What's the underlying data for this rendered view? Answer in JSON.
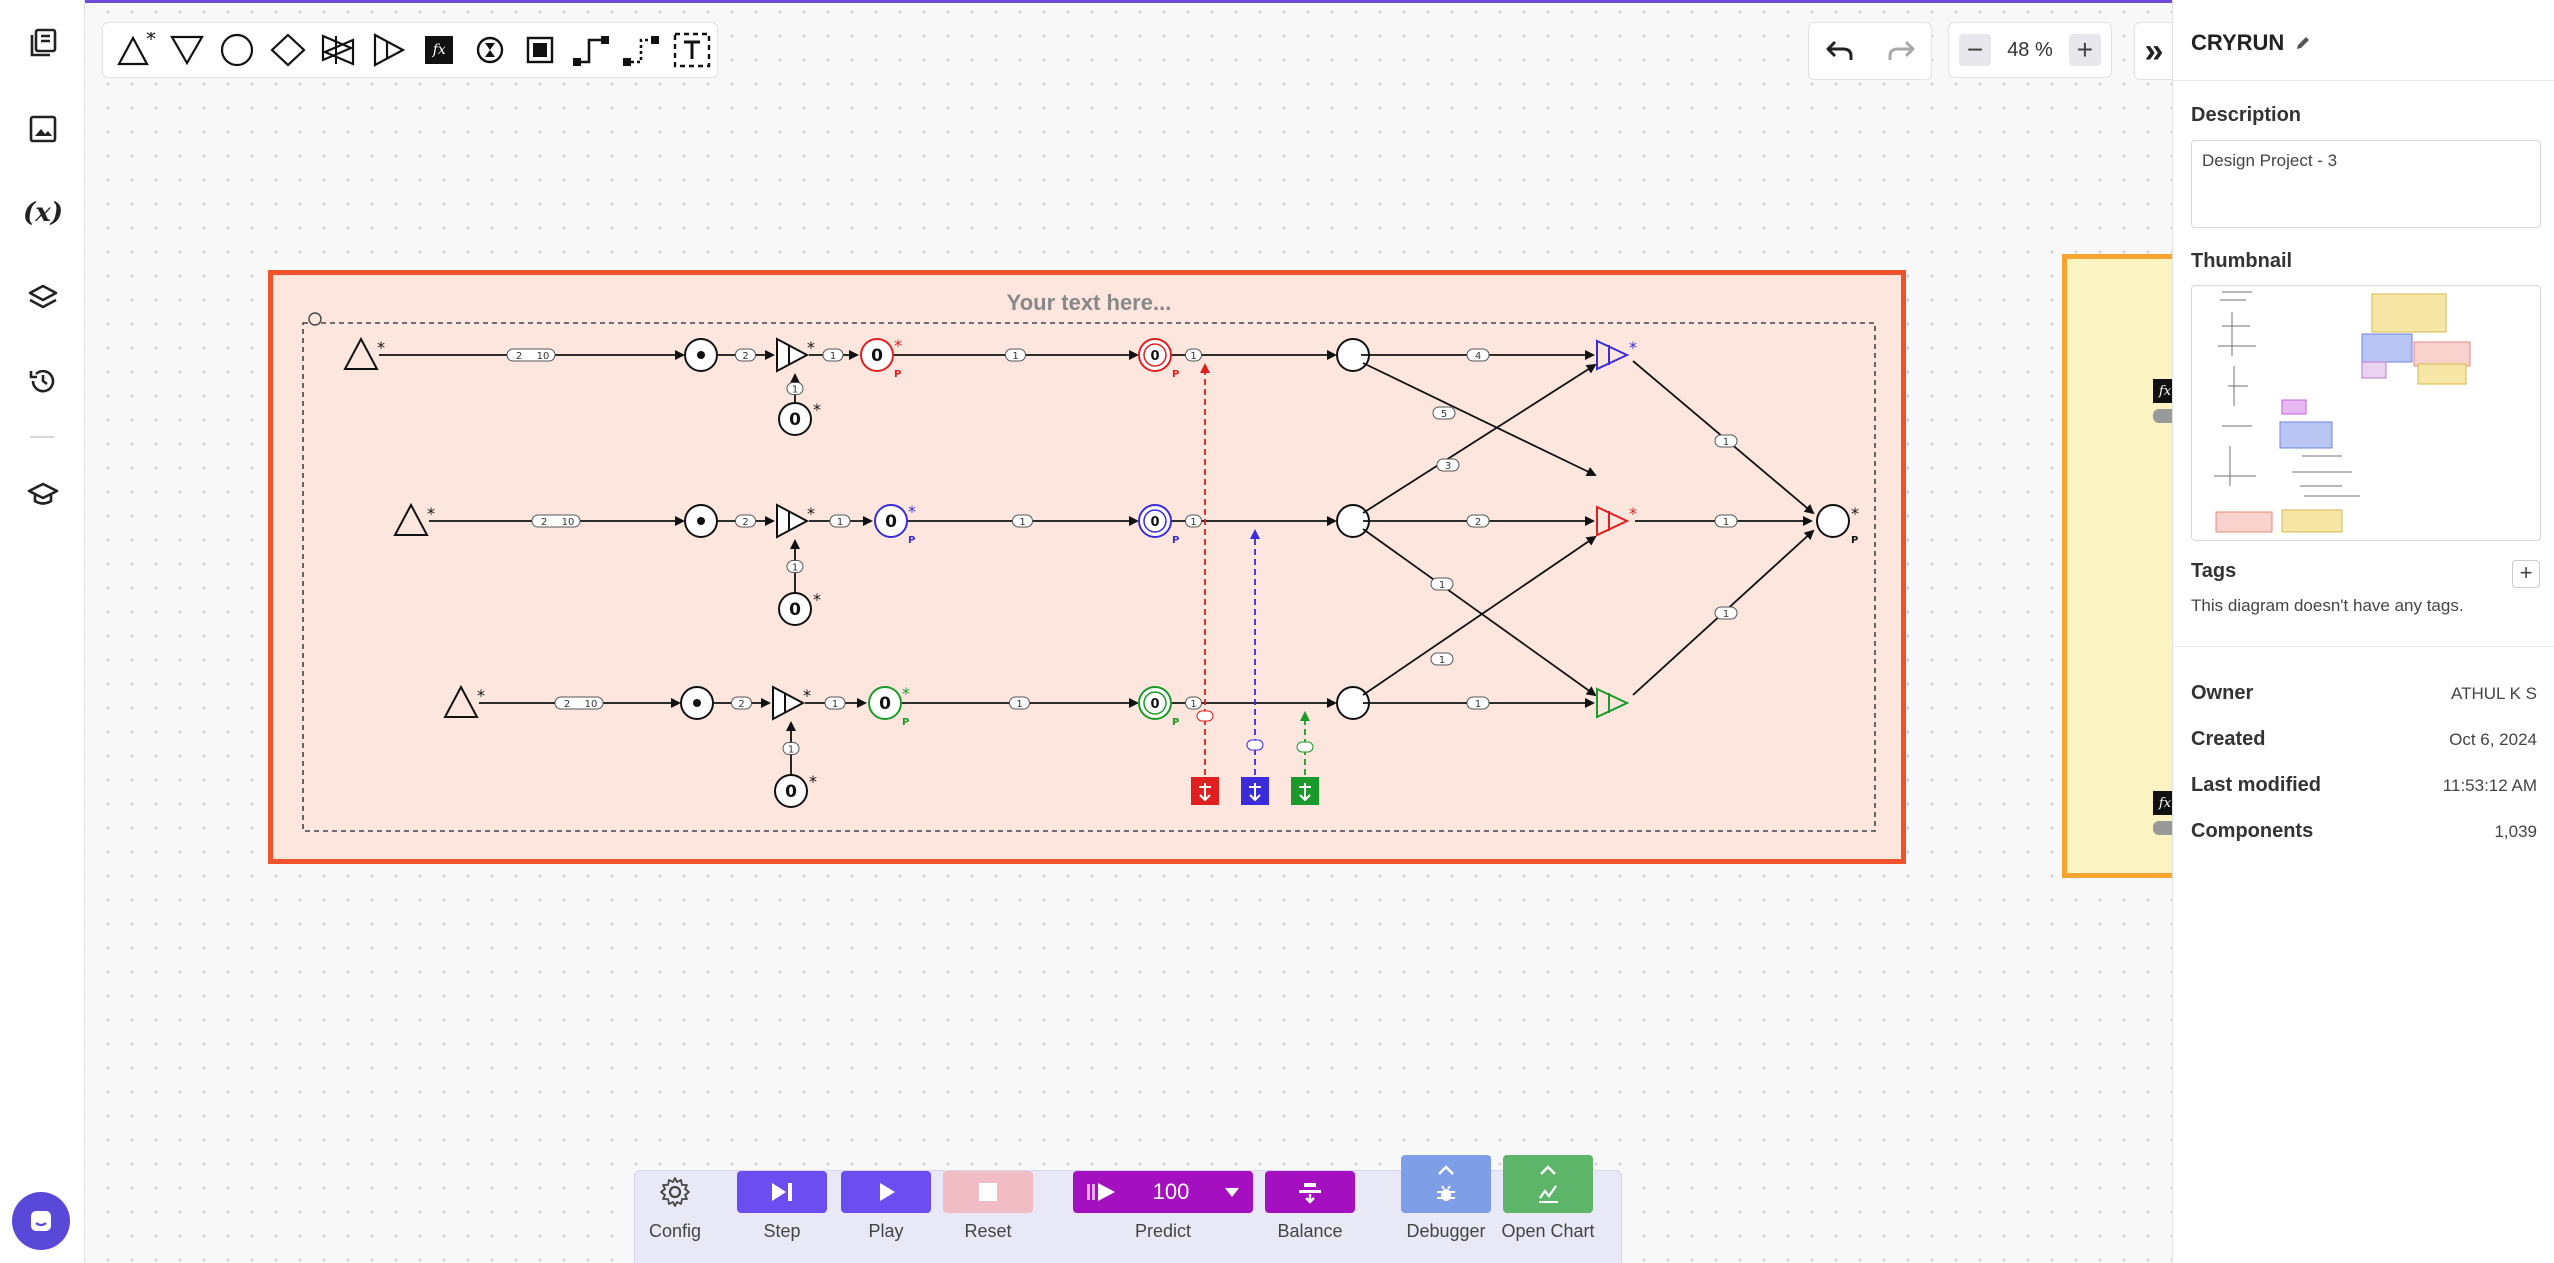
{
  "project": {
    "name": "CRYRUN",
    "description_label": "Description",
    "description": "Design Project - 3",
    "thumbnail_label": "Thumbnail",
    "tags_label": "Tags",
    "tags_add": "+",
    "tags_empty": "This diagram doesn't have any tags.",
    "meta": [
      {
        "key": "Owner",
        "value": "ATHUL K S"
      },
      {
        "key": "Created",
        "value": "Oct 6, 2024"
      },
      {
        "key": "Last modified",
        "value": "11:53:12 AM"
      },
      {
        "key": "Components",
        "value": "1,039"
      }
    ]
  },
  "rail": {
    "icons": [
      "library-icon",
      "image-icon",
      "variable-icon",
      "layers-icon",
      "history-icon",
      "learn-icon"
    ],
    "variable_glyph": "(x)"
  },
  "toolbar": {
    "tools": [
      "source-tool",
      "sink-tool",
      "pool-tool",
      "gate-tool",
      "converter-tool",
      "trader-tool",
      "formula-tool",
      "delay-tool",
      "register-tool",
      "resource-connection-tool",
      "state-connection-tool",
      "text-tool"
    ],
    "fx_glyph": "fx"
  },
  "zoom": {
    "value": "48",
    "unit": "%",
    "minus": "−",
    "plus": "+"
  },
  "collapse_glyph": "»",
  "canvas": {
    "group_label": "Your text here...",
    "colors": {
      "frame": "#f0532b",
      "fill": "#fde6dd",
      "red": "#e02020",
      "blue": "#3a2cd8",
      "green": "#1a9a2a",
      "frame2": "#f7a431"
    },
    "flow_labels": {
      "source_rate": "2",
      "source_cap": "10",
      "gate_out": "2",
      "trader_out": "1",
      "pool_out": "1",
      "pool_in": "1",
      "zero": "0",
      "star": "*",
      "p": "P",
      "w1": "4",
      "w2": "5",
      "w3": "3",
      "w4": "2",
      "w5": "1",
      "w6": "1",
      "w7": "1",
      "out1": "1",
      "out2": "1",
      "out3": "1"
    }
  },
  "controls": {
    "config": "Config",
    "step": "Step",
    "play": "Play",
    "reset": "Reset",
    "predict": "Predict",
    "predict_runs": "100",
    "balance": "Balance",
    "debugger": "Debugger",
    "open_chart": "Open Chart"
  }
}
